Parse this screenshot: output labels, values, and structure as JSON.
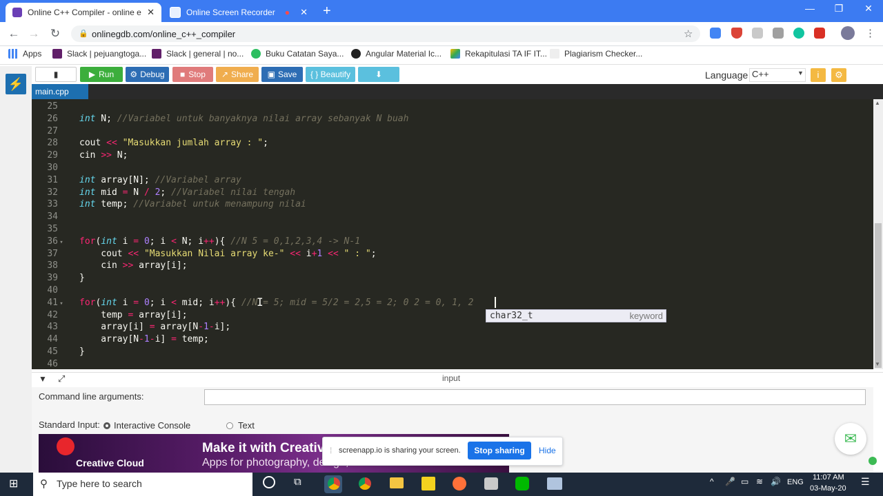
{
  "browser": {
    "tabs": [
      {
        "title": "Online C++ Compiler - online ed",
        "active": true
      },
      {
        "title": "Online Screen Recorder",
        "active": false
      }
    ],
    "url": "onlinegdb.com/online_c++_compiler",
    "bookmarks": [
      "Apps",
      "Slack | pejuangtoga...",
      "Slack | general | no...",
      "Buku Catatan Saya...",
      "Angular Material Ic...",
      "Rekapitulasi TA IF IT...",
      "Plagiarism Checker..."
    ]
  },
  "toolbar": {
    "run": "Run",
    "debug": "Debug",
    "stop": "Stop",
    "share": "Share",
    "save": "Save",
    "beautify": "{ } Beautify",
    "language_label": "Language",
    "language_value": "C++"
  },
  "file_tab": "main.cpp",
  "editor": {
    "lines": [
      {
        "n": "25",
        "segs": []
      },
      {
        "n": "26",
        "segs": [
          [
            "kw",
            "int"
          ],
          [
            "t",
            " N; "
          ],
          [
            "cm",
            "//Variabel untuk banyaknya nilai array sebanyak N buah"
          ]
        ]
      },
      {
        "n": "27",
        "segs": []
      },
      {
        "n": "28",
        "segs": [
          [
            "t",
            "cout "
          ],
          [
            "op",
            "<<"
          ],
          [
            "t",
            " "
          ],
          [
            "str",
            "\"Masukkan jumlah array : \""
          ],
          [
            "t",
            ";"
          ]
        ]
      },
      {
        "n": "29",
        "segs": [
          [
            "t",
            "cin "
          ],
          [
            "op",
            ">>"
          ],
          [
            "t",
            " N;"
          ]
        ]
      },
      {
        "n": "30",
        "segs": []
      },
      {
        "n": "31",
        "segs": [
          [
            "kw",
            "int"
          ],
          [
            "t",
            " array[N]; "
          ],
          [
            "cm",
            "//Variabel array"
          ]
        ]
      },
      {
        "n": "32",
        "segs": [
          [
            "kw",
            "int"
          ],
          [
            "t",
            " mid "
          ],
          [
            "op",
            "="
          ],
          [
            "t",
            " N "
          ],
          [
            "op",
            "/"
          ],
          [
            "t",
            " "
          ],
          [
            "num",
            "2"
          ],
          [
            "t",
            "; "
          ],
          [
            "cm",
            "//Variabel nilai tengah"
          ]
        ]
      },
      {
        "n": "33",
        "segs": [
          [
            "kw",
            "int"
          ],
          [
            "t",
            " temp; "
          ],
          [
            "cm",
            "//Variabel untuk menampung nilai"
          ]
        ]
      },
      {
        "n": "34",
        "segs": []
      },
      {
        "n": "35",
        "segs": []
      },
      {
        "n": "36",
        "fold": true,
        "segs": [
          [
            "op",
            "for"
          ],
          [
            "t",
            "("
          ],
          [
            "kw",
            "int"
          ],
          [
            "t",
            " i "
          ],
          [
            "op",
            "="
          ],
          [
            "t",
            " "
          ],
          [
            "num",
            "0"
          ],
          [
            "t",
            "; i "
          ],
          [
            "op",
            "<"
          ],
          [
            "t",
            " N; i"
          ],
          [
            "op",
            "++"
          ],
          [
            "t",
            "){ "
          ],
          [
            "cm",
            "//N 5 = 0,1,2,3,4 -> N-1"
          ]
        ]
      },
      {
        "n": "37",
        "segs": [
          [
            "t",
            "    cout "
          ],
          [
            "op",
            "<<"
          ],
          [
            "t",
            " "
          ],
          [
            "str",
            "\"Masukkan Nilai array ke-\""
          ],
          [
            "t",
            " "
          ],
          [
            "op",
            "<<"
          ],
          [
            "t",
            " i"
          ],
          [
            "op",
            "+"
          ],
          [
            "num",
            "1"
          ],
          [
            "t",
            " "
          ],
          [
            "op",
            "<<"
          ],
          [
            "t",
            " "
          ],
          [
            "str",
            "\" : \""
          ],
          [
            "t",
            ";"
          ]
        ]
      },
      {
        "n": "38",
        "segs": [
          [
            "t",
            "    cin "
          ],
          [
            "op",
            ">>"
          ],
          [
            "t",
            " array[i];"
          ]
        ]
      },
      {
        "n": "39",
        "segs": [
          [
            "t",
            "}"
          ]
        ]
      },
      {
        "n": "40",
        "segs": []
      },
      {
        "n": "41",
        "fold": true,
        "segs": [
          [
            "op",
            "for"
          ],
          [
            "t",
            "("
          ],
          [
            "kw",
            "int"
          ],
          [
            "t",
            " i "
          ],
          [
            "op",
            "="
          ],
          [
            "t",
            " "
          ],
          [
            "num",
            "0"
          ],
          [
            "t",
            "; i "
          ],
          [
            "op",
            "<"
          ],
          [
            "t",
            " mid; i"
          ],
          [
            "op",
            "++"
          ],
          [
            "t",
            "){ "
          ],
          [
            "cm",
            "//N = 5; mid = 5/2 = 2,5 = 2; 0 2 = 0, 1, 2"
          ]
        ]
      },
      {
        "n": "42",
        "segs": [
          [
            "t",
            "    temp "
          ],
          [
            "op",
            "="
          ],
          [
            "t",
            " array[i];"
          ]
        ]
      },
      {
        "n": "43",
        "segs": [
          [
            "t",
            "    array[i] "
          ],
          [
            "op",
            "="
          ],
          [
            "t",
            " array[N"
          ],
          [
            "op",
            "-"
          ],
          [
            "num",
            "1"
          ],
          [
            "op",
            "-"
          ],
          [
            "t",
            "i];"
          ]
        ]
      },
      {
        "n": "44",
        "segs": [
          [
            "t",
            "    array[N"
          ],
          [
            "op",
            "-"
          ],
          [
            "num",
            "1"
          ],
          [
            "op",
            "-"
          ],
          [
            "t",
            "i] "
          ],
          [
            "op",
            "="
          ],
          [
            "t",
            " temp;"
          ]
        ]
      },
      {
        "n": "45",
        "segs": [
          [
            "t",
            "}"
          ]
        ]
      },
      {
        "n": "46",
        "segs": []
      }
    ],
    "autocomplete": {
      "item": "char32_t",
      "kind": "keyword"
    }
  },
  "input_panel": {
    "title": "input",
    "cmd_label": "Command line arguments:",
    "stdin_label": "Standard Input:",
    "interactive_label": "Interactive Console",
    "text_label": "Text"
  },
  "ad": {
    "headline": "Make it with Creativ",
    "sub": "Apps for photography, design, video",
    "brand": "Creative Cloud"
  },
  "sharing": {
    "message": "screenapp.io is sharing your screen.",
    "stop": "Stop sharing",
    "hide": "Hide"
  },
  "taskbar": {
    "search_placeholder": "Type here to search",
    "lang": "ENG",
    "time": "11:07 AM",
    "date": "03-May-20"
  }
}
